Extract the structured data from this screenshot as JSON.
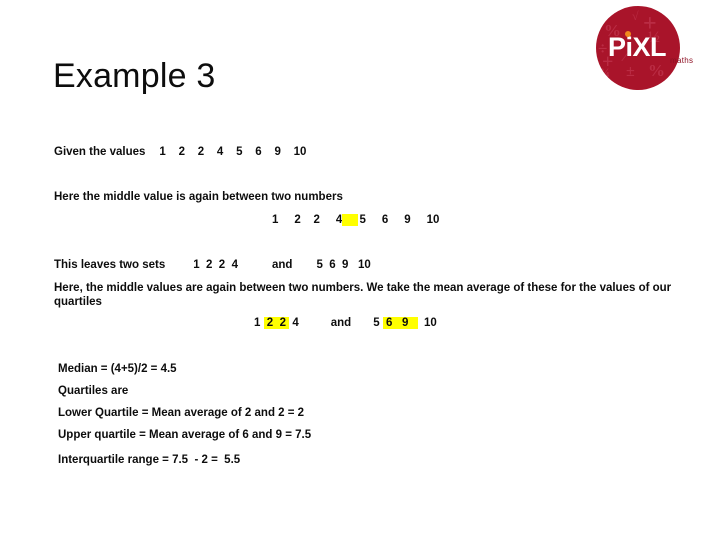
{
  "slide": {
    "title": "Example 3",
    "logo": {
      "wordmark": "PiXL",
      "sub": "maths",
      "circle_color": "#a9142a",
      "dot_color": "#f08a1e",
      "symbols": [
        "%",
        "+",
        "√",
        "½",
        "÷",
        "−",
        "¾",
        "±",
        "%",
        "⁄"
      ]
    },
    "lines": {
      "given_label": "Given the values",
      "given_values": "1    2    2    4    5    6    9    10",
      "here_middle_value": "Here the middle value is again between two numbers",
      "values_row_a": "1     2    2     4",
      "values_row_a_hl": " ",
      "values_row_a_after": "5     6     9     10",
      "this_leaves": "This leaves two sets",
      "set_one": "1  2  2  4",
      "and_word": "and",
      "set_two": "5  6  9   10",
      "here_middle_values": "Here, the middle values are again between two numbers.  We take the mean average of these for the values of our quartiles",
      "row_b_first": "1 ",
      "row_b_hl1": " 2  2 ",
      "row_b_mid": " 4",
      "row_b_and": "and",
      "row_b_five": "5 ",
      "row_b_hl2": " 6   9   ",
      "row_b_ten": "10",
      "median": "Median = (4+5)/2 = 4.5",
      "quartiles_are": "Quartiles are",
      "lower_quartile": "Lower Quartile = Mean average of 2 and 2 = 2",
      "upper_quartile": "Upper quartile = Mean average of 6 and 9 = 7.5",
      "interquartile": "Interquartile range = 7.5  - 2 =  5.5"
    }
  }
}
